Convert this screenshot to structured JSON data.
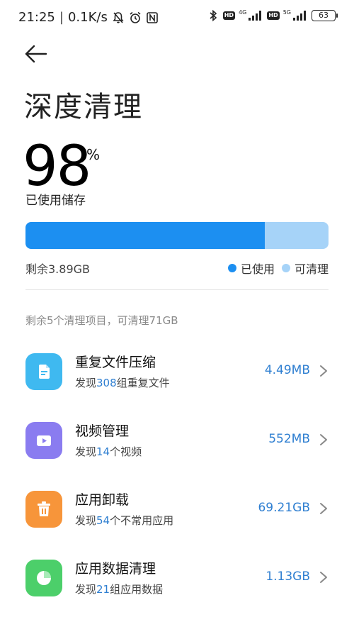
{
  "status_bar": {
    "time": "21:25",
    "separator": "|",
    "speed": "0.1K/s",
    "hd1": "HD",
    "net1": "4G",
    "hd2": "HD",
    "net2": "5G",
    "battery": "63",
    "icons": [
      "mute-bell-icon",
      "alarm-icon",
      "nfc-icon",
      "bluetooth-icon",
      "signal-icon",
      "signal-icon"
    ]
  },
  "header": {
    "back_icon": "arrow-left-icon",
    "title": "深度清理"
  },
  "usage": {
    "percent": "98",
    "percent_sign": "%",
    "label": "已使用储存",
    "used_fraction": 0.79,
    "cleanable_fraction": 0.28,
    "remaining": "剩余3.89GB",
    "legend": [
      {
        "label": "已使用",
        "color": "#1c8ff1"
      },
      {
        "label": "可清理",
        "color": "#a6d3f8"
      }
    ]
  },
  "summary": "剩余5个清理项目，可清理71GB",
  "items": [
    {
      "title": "重复文件压缩",
      "sub_prefix": "发现",
      "count": "308",
      "sub_suffix": "组重复文件",
      "size": "4.49MB",
      "icon": "file-duplicate-icon",
      "color": "#3fb9f0"
    },
    {
      "title": "视频管理",
      "sub_prefix": "发现",
      "count": "14",
      "sub_suffix": "个视频",
      "size": "552MB",
      "icon": "video-icon",
      "color": "#8a7cf0"
    },
    {
      "title": "应用卸载",
      "sub_prefix": "发现",
      "count": "54",
      "sub_suffix": "个不常用应用",
      "size": "69.21GB",
      "icon": "trash-icon",
      "color": "#f7953a"
    },
    {
      "title": "应用数据清理",
      "sub_prefix": "发现",
      "count": "21",
      "sub_suffix": "组应用数据",
      "size": "1.13GB",
      "icon": "pie-chart-icon",
      "color": "#4ccf6a"
    }
  ]
}
